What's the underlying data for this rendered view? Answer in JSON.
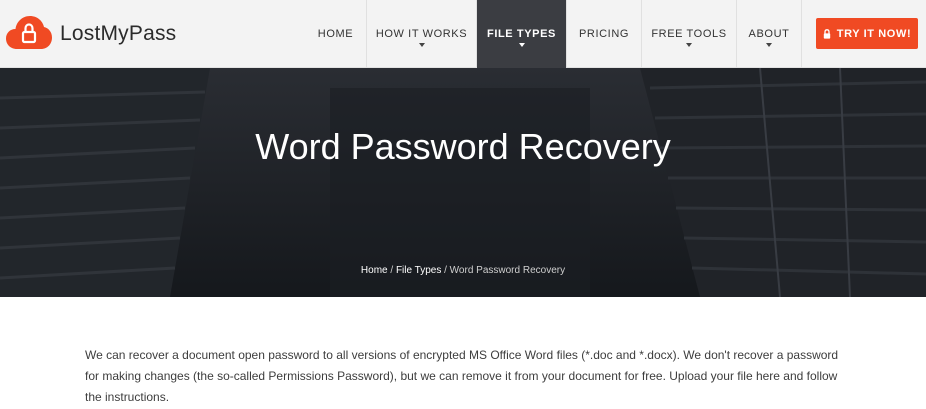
{
  "header": {
    "logo_text": "LostMyPass",
    "nav": [
      {
        "label": "HOME",
        "caret": false,
        "active": false
      },
      {
        "label": "HOW IT WORKS",
        "caret": true,
        "active": false
      },
      {
        "label": "FILE TYPES",
        "caret": true,
        "active": true
      },
      {
        "label": "PRICING",
        "caret": false,
        "active": false
      },
      {
        "label": "FREE TOOLS",
        "caret": true,
        "active": false
      },
      {
        "label": "ABOUT",
        "caret": true,
        "active": false
      }
    ],
    "cta_label": "TRY IT NOW!"
  },
  "hero": {
    "title": "Word Password Recovery",
    "breadcrumb": {
      "home": "Home",
      "separator": "/",
      "section": "File Types",
      "current": "Word Password Recovery"
    }
  },
  "content": {
    "intro": "We can recover a document open password to all versions of encrypted MS Office Word files (*.doc and *.docx). We don't recover a password for making changes (the so-called Permissions Password), but we can remove it from your document for free. Upload your file here and follow the instructions."
  },
  "colors": {
    "accent": "#f04a23",
    "nav_active_bg": "#3b3d42",
    "header_bg": "#f3f3f3",
    "hero_bg": "#1a1d22"
  },
  "icons": {
    "logo": "cloud-lock-icon",
    "cta": "lock-icon",
    "dropdown": "caret-down-icon"
  }
}
